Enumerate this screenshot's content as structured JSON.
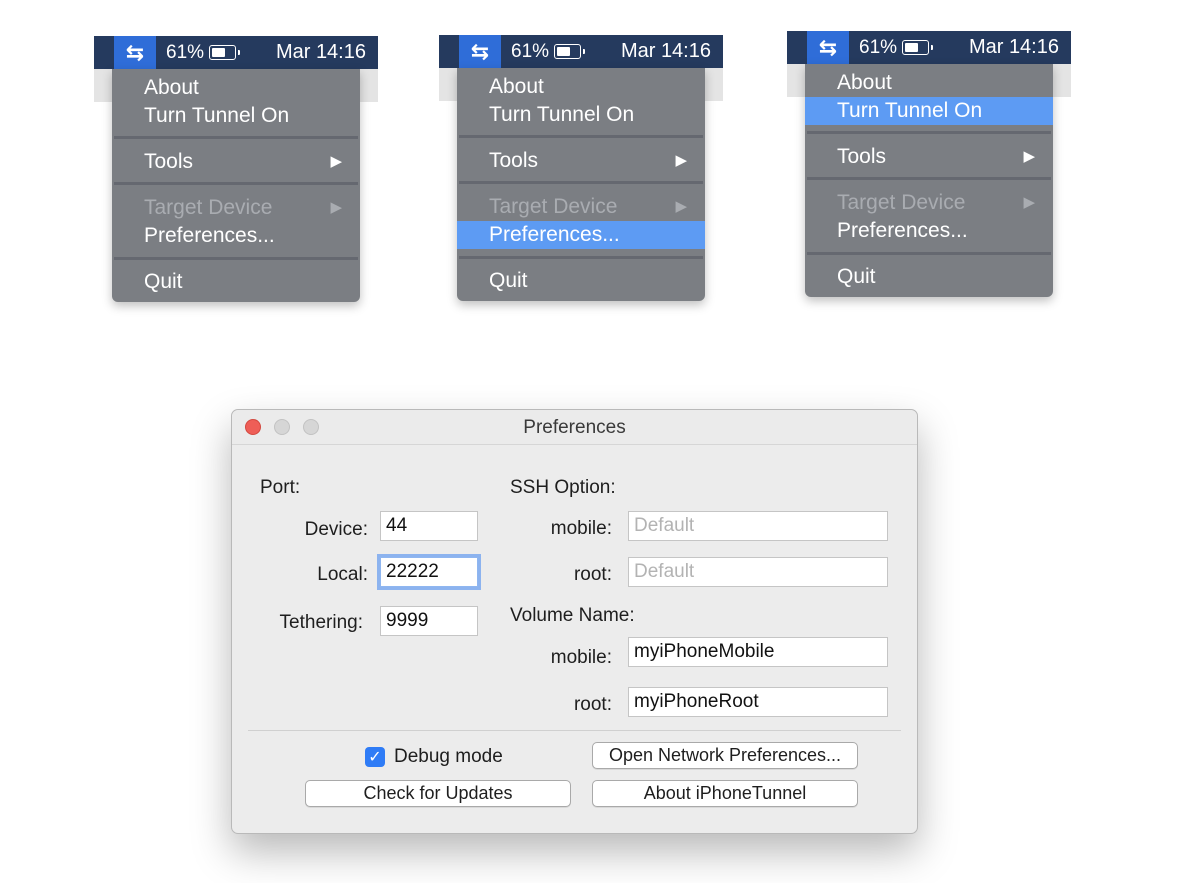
{
  "menubar": {
    "battery_percent": "61%",
    "clock": "Mar 14:16",
    "app_icon": "tunnel-arrows-icon"
  },
  "menu": {
    "about": "About",
    "turn_tunnel_on": "Turn Tunnel On",
    "tools": "Tools",
    "target_device": "Target Device",
    "preferences": "Preferences...",
    "quit": "Quit",
    "submenu_arrow": "▶"
  },
  "panels": [
    {
      "highlighted": "none"
    },
    {
      "highlighted": "preferences"
    },
    {
      "highlighted": "turn_tunnel_on"
    }
  ],
  "window": {
    "title": "Preferences",
    "port": {
      "heading": "Port:",
      "device_label": "Device:",
      "device_value": "44",
      "local_label": "Local:",
      "local_value": "22222",
      "tethering_label": "Tethering:",
      "tethering_value": "9999"
    },
    "ssh": {
      "heading": "SSH Option:",
      "mobile_label": "mobile:",
      "mobile_placeholder": "Default",
      "root_label": "root:",
      "root_placeholder": "Default"
    },
    "volume": {
      "heading": "Volume Name:",
      "mobile_label": "mobile:",
      "mobile_value": "myiPhoneMobile",
      "root_label": "root:",
      "root_value": "myiPhoneRoot"
    },
    "debug_mode_label": "Debug mode",
    "debug_mode_checked": true,
    "open_network_button": "Open Network Preferences...",
    "check_updates_button": "Check for Updates",
    "about_button": "About iPhoneTunnel"
  },
  "colors": {
    "menubar_bg": "#253a5e",
    "menu_bg": "#7b7e83",
    "menu_highlight": "#5d9bf3",
    "close_button": "#ee5e57",
    "checkbox": "#2f7cf6"
  }
}
